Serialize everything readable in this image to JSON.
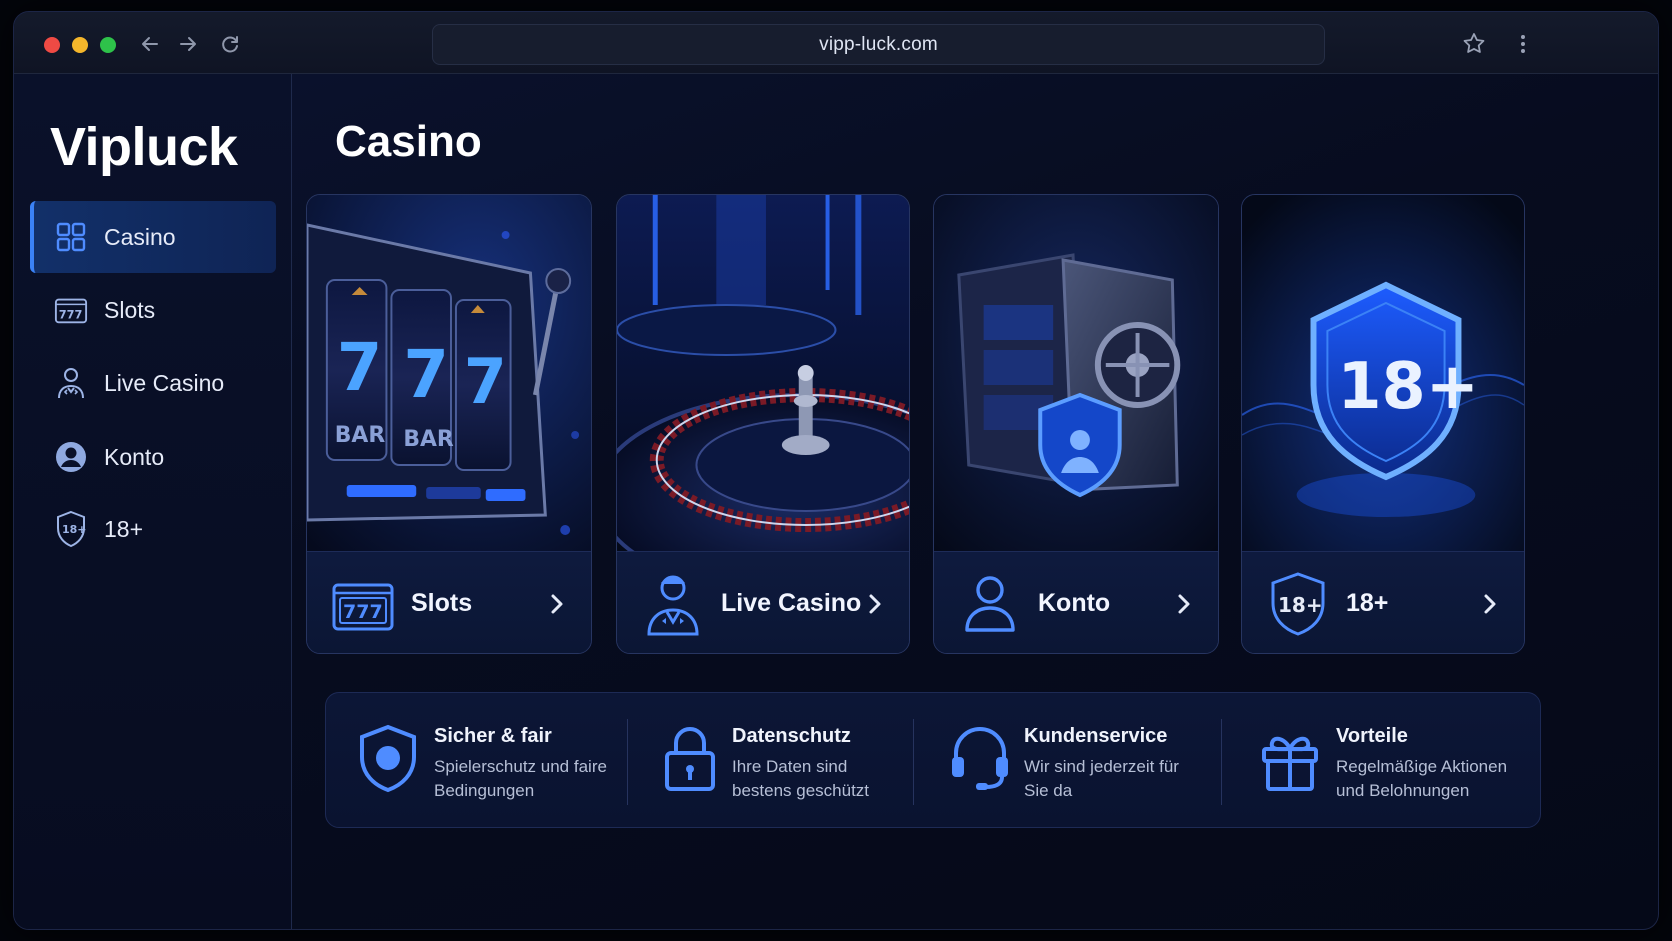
{
  "browser": {
    "url": "vipp-luck.com",
    "back_icon": "arrow-left-icon",
    "forward_icon": "arrow-right-icon",
    "reload_icon": "reload-icon",
    "bookmark_icon": "star-icon",
    "menu_icon": "kebab-menu-icon"
  },
  "sidebar": {
    "brand": "Vipluck",
    "items": [
      {
        "label": "Casino",
        "icon": "grid-icon",
        "active": true
      },
      {
        "label": "Slots",
        "icon": "slot-machine-icon",
        "active": false
      },
      {
        "label": "Live Casino",
        "icon": "dealer-icon",
        "active": false
      },
      {
        "label": "Konto",
        "icon": "user-circle-icon",
        "active": false
      },
      {
        "label": "18+",
        "icon": "age-shield-icon",
        "active": false
      }
    ]
  },
  "main": {
    "title": "Casino",
    "cards": [
      {
        "label": "Slots",
        "icon": "slot-machine-icon",
        "image": "slot-machine-777-illustration",
        "reel_text": [
          "7",
          "7",
          "7"
        ],
        "symbol_text": "BAR"
      },
      {
        "label": "Live Casino",
        "icon": "dealer-icon",
        "image": "roulette-wheel-illustration"
      },
      {
        "label": "Konto",
        "icon": "user-icon",
        "image": "safe-with-shield-illustration"
      },
      {
        "label": "18+",
        "icon": "age-shield-icon",
        "image": "glowing-18-shield-illustration",
        "badge_text": "18+"
      }
    ],
    "features": [
      {
        "title": "Sicher & fair",
        "desc": "Spielerschutz und faire Bedingungen",
        "icon": "shield-icon"
      },
      {
        "title": "Datenschutz",
        "desc": "Ihre Daten sind bestens geschützt",
        "icon": "lock-icon"
      },
      {
        "title": "Kundenservice",
        "desc": "Wir sind jederzeit für Sie da",
        "icon": "headset-icon"
      },
      {
        "title": "Vorteile",
        "desc": "Regelmäßige Aktionen und Belohnungen",
        "icon": "gift-icon"
      }
    ]
  },
  "colors": {
    "accent": "#3b82f6",
    "background": "#070c1f",
    "card": "#0b1634"
  }
}
